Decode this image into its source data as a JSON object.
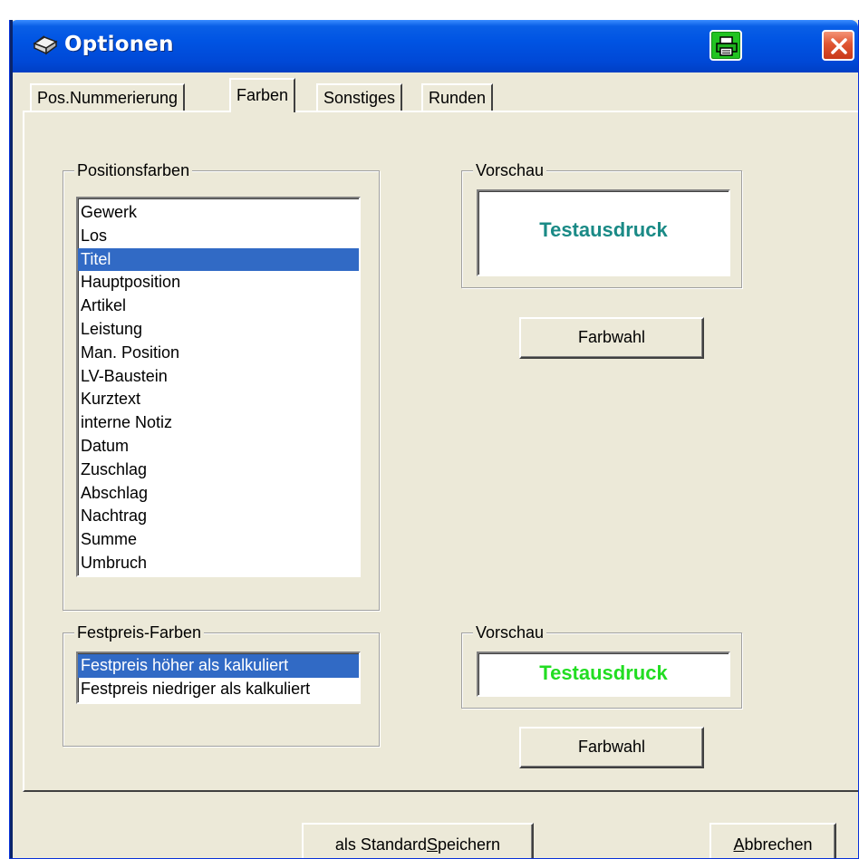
{
  "window": {
    "title": "Optionen"
  },
  "tabs": [
    {
      "label": "Pos.Nummerierung"
    },
    {
      "label": "Farben"
    },
    {
      "label": "Sonstiges"
    },
    {
      "label": "Runden"
    }
  ],
  "positionsfarben": {
    "label": "Positionsfarben",
    "items": [
      "Gewerk",
      "Los",
      "Titel",
      "Hauptposition",
      "Artikel",
      "Leistung",
      "Man. Position",
      "LV-Baustein",
      "Kurztext",
      "interne Notiz",
      "Datum",
      "Zuschlag",
      "Abschlag",
      "Nachtrag",
      "Summe",
      "Umbruch"
    ],
    "selected": "Titel"
  },
  "vorschau1": {
    "label": "Vorschau",
    "text": "Testausdruck",
    "color": "#1a8a86"
  },
  "farbwahl1": {
    "label": "Farbwahl"
  },
  "festpreis": {
    "label": "Festpreis-Farben",
    "items": [
      "Festpreis höher als kalkuliert",
      "Festpreis niedriger als kalkuliert"
    ],
    "selected": "Festpreis höher als kalkuliert"
  },
  "vorschau2": {
    "label": "Vorschau",
    "text": "Testausdruck",
    "color": "#22dd22"
  },
  "farbwahl2": {
    "label": "Farbwahl"
  },
  "footer": {
    "save_prefix": "als Standard ",
    "save_mnemonic": "S",
    "save_suffix": "peichern",
    "cancel_mnemonic": "A",
    "cancel_suffix": "bbrechen"
  },
  "colors": {
    "selection": "#316ac5",
    "dialog_bg": "#ece9d8",
    "titlebar": "#0054e3"
  }
}
